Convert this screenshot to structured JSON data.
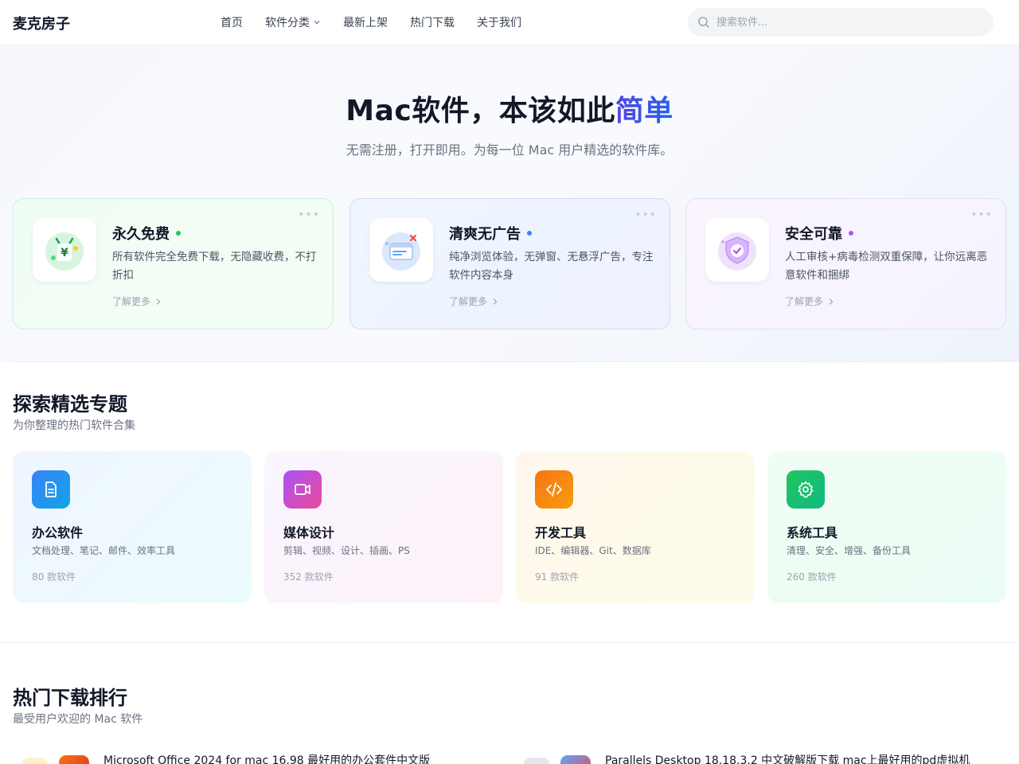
{
  "header": {
    "logo": "麦克房子",
    "nav": [
      "首页",
      "软件分类",
      "最新上架",
      "热门下载",
      "关于我们"
    ],
    "search_placeholder": "搜索软件..."
  },
  "hero": {
    "title_main": "Mac软件，本该如此",
    "title_accent": "简单",
    "subtitle": "无需注册，打开即用。为每一位 Mac 用户精选的软件库。"
  },
  "features": [
    {
      "title": "永久免费",
      "desc": "所有软件完全免费下载，无隐藏收费，不打折扣",
      "more": "了解更多",
      "dot_color": "#22c55e",
      "icon": "yen-bag-icon"
    },
    {
      "title": "清爽无广告",
      "desc": "纯净浏览体验，无弹窗、无悬浮广告，专注软件内容本身",
      "more": "了解更多",
      "dot_color": "#3b82f6",
      "icon": "no-ads-window-icon"
    },
    {
      "title": "安全可靠",
      "desc": "人工审核+病毒检测双重保障，让你远离恶意软件和捆绑",
      "more": "了解更多",
      "dot_color": "#a855f7",
      "icon": "shield-check-icon"
    }
  ],
  "topics_section": {
    "title": "探索精选专题",
    "subtitle": "为你整理的热门软件合集",
    "items": [
      {
        "title": "办公软件",
        "desc": "文档处理、笔记、邮件、效率工具",
        "count": "80 款软件",
        "icon": "document-icon"
      },
      {
        "title": "媒体设计",
        "desc": "剪辑、视频、设计、插画、PS",
        "count": "352 款软件",
        "icon": "video-icon"
      },
      {
        "title": "开发工具",
        "desc": "IDE、编辑器、Git、数据库",
        "count": "91 款软件",
        "icon": "code-icon"
      },
      {
        "title": "系统工具",
        "desc": "清理、安全、增强、备份工具",
        "count": "260 款软件",
        "icon": "gear-icon"
      }
    ]
  },
  "ranking_section": {
    "title": "热门下载排行",
    "subtitle": "最受用户欢迎的 Mac 软件",
    "items": [
      {
        "text": "Microsoft Office 2024 for mac 16.98 最好用的办公套件中文版"
      },
      {
        "text": "Parallels Desktop 18.18.3.2 中文破解版下载 mac上最好用的pd虚拟机"
      }
    ]
  }
}
